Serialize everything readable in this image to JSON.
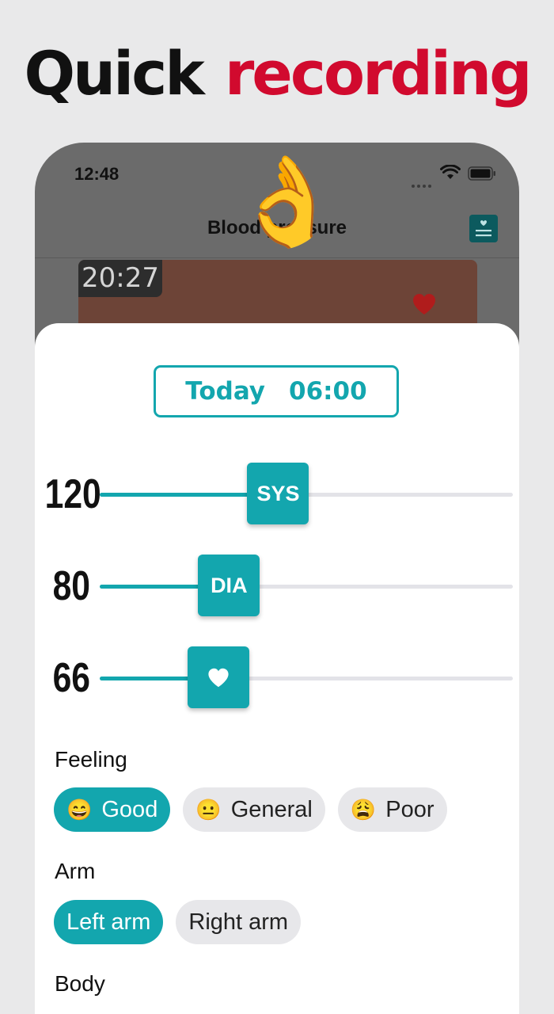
{
  "headline": {
    "word1": "Quick",
    "word2": "recording"
  },
  "status_bar": {
    "time": "12:48"
  },
  "nav": {
    "title": "Blood pressure"
  },
  "record_card": {
    "time": "20:27"
  },
  "entry": {
    "date_day": "Today",
    "date_time": "06:00",
    "sliders": [
      {
        "value": "120",
        "thumb_label": "SYS",
        "level": 0.42
      },
      {
        "value": "80",
        "thumb_label": "DIA",
        "level": 0.28
      },
      {
        "value": "66",
        "thumb_label": "",
        "thumb_icon": "heart-icon",
        "level": 0.25
      }
    ],
    "feeling": {
      "label": "Feeling",
      "options": [
        {
          "emoji": "😄",
          "label": "Good",
          "selected": true
        },
        {
          "emoji": "😐",
          "label": "General",
          "selected": false
        },
        {
          "emoji": "😩",
          "label": "Poor",
          "selected": false
        }
      ]
    },
    "arm": {
      "label": "Arm",
      "options": [
        {
          "label": "Left arm",
          "selected": true
        },
        {
          "label": "Right arm",
          "selected": false
        }
      ]
    },
    "body": {
      "label": "Body"
    }
  },
  "colors": {
    "accent": "#13a6ae",
    "brand_red": "#d10a2e",
    "card": "#6d4437"
  }
}
